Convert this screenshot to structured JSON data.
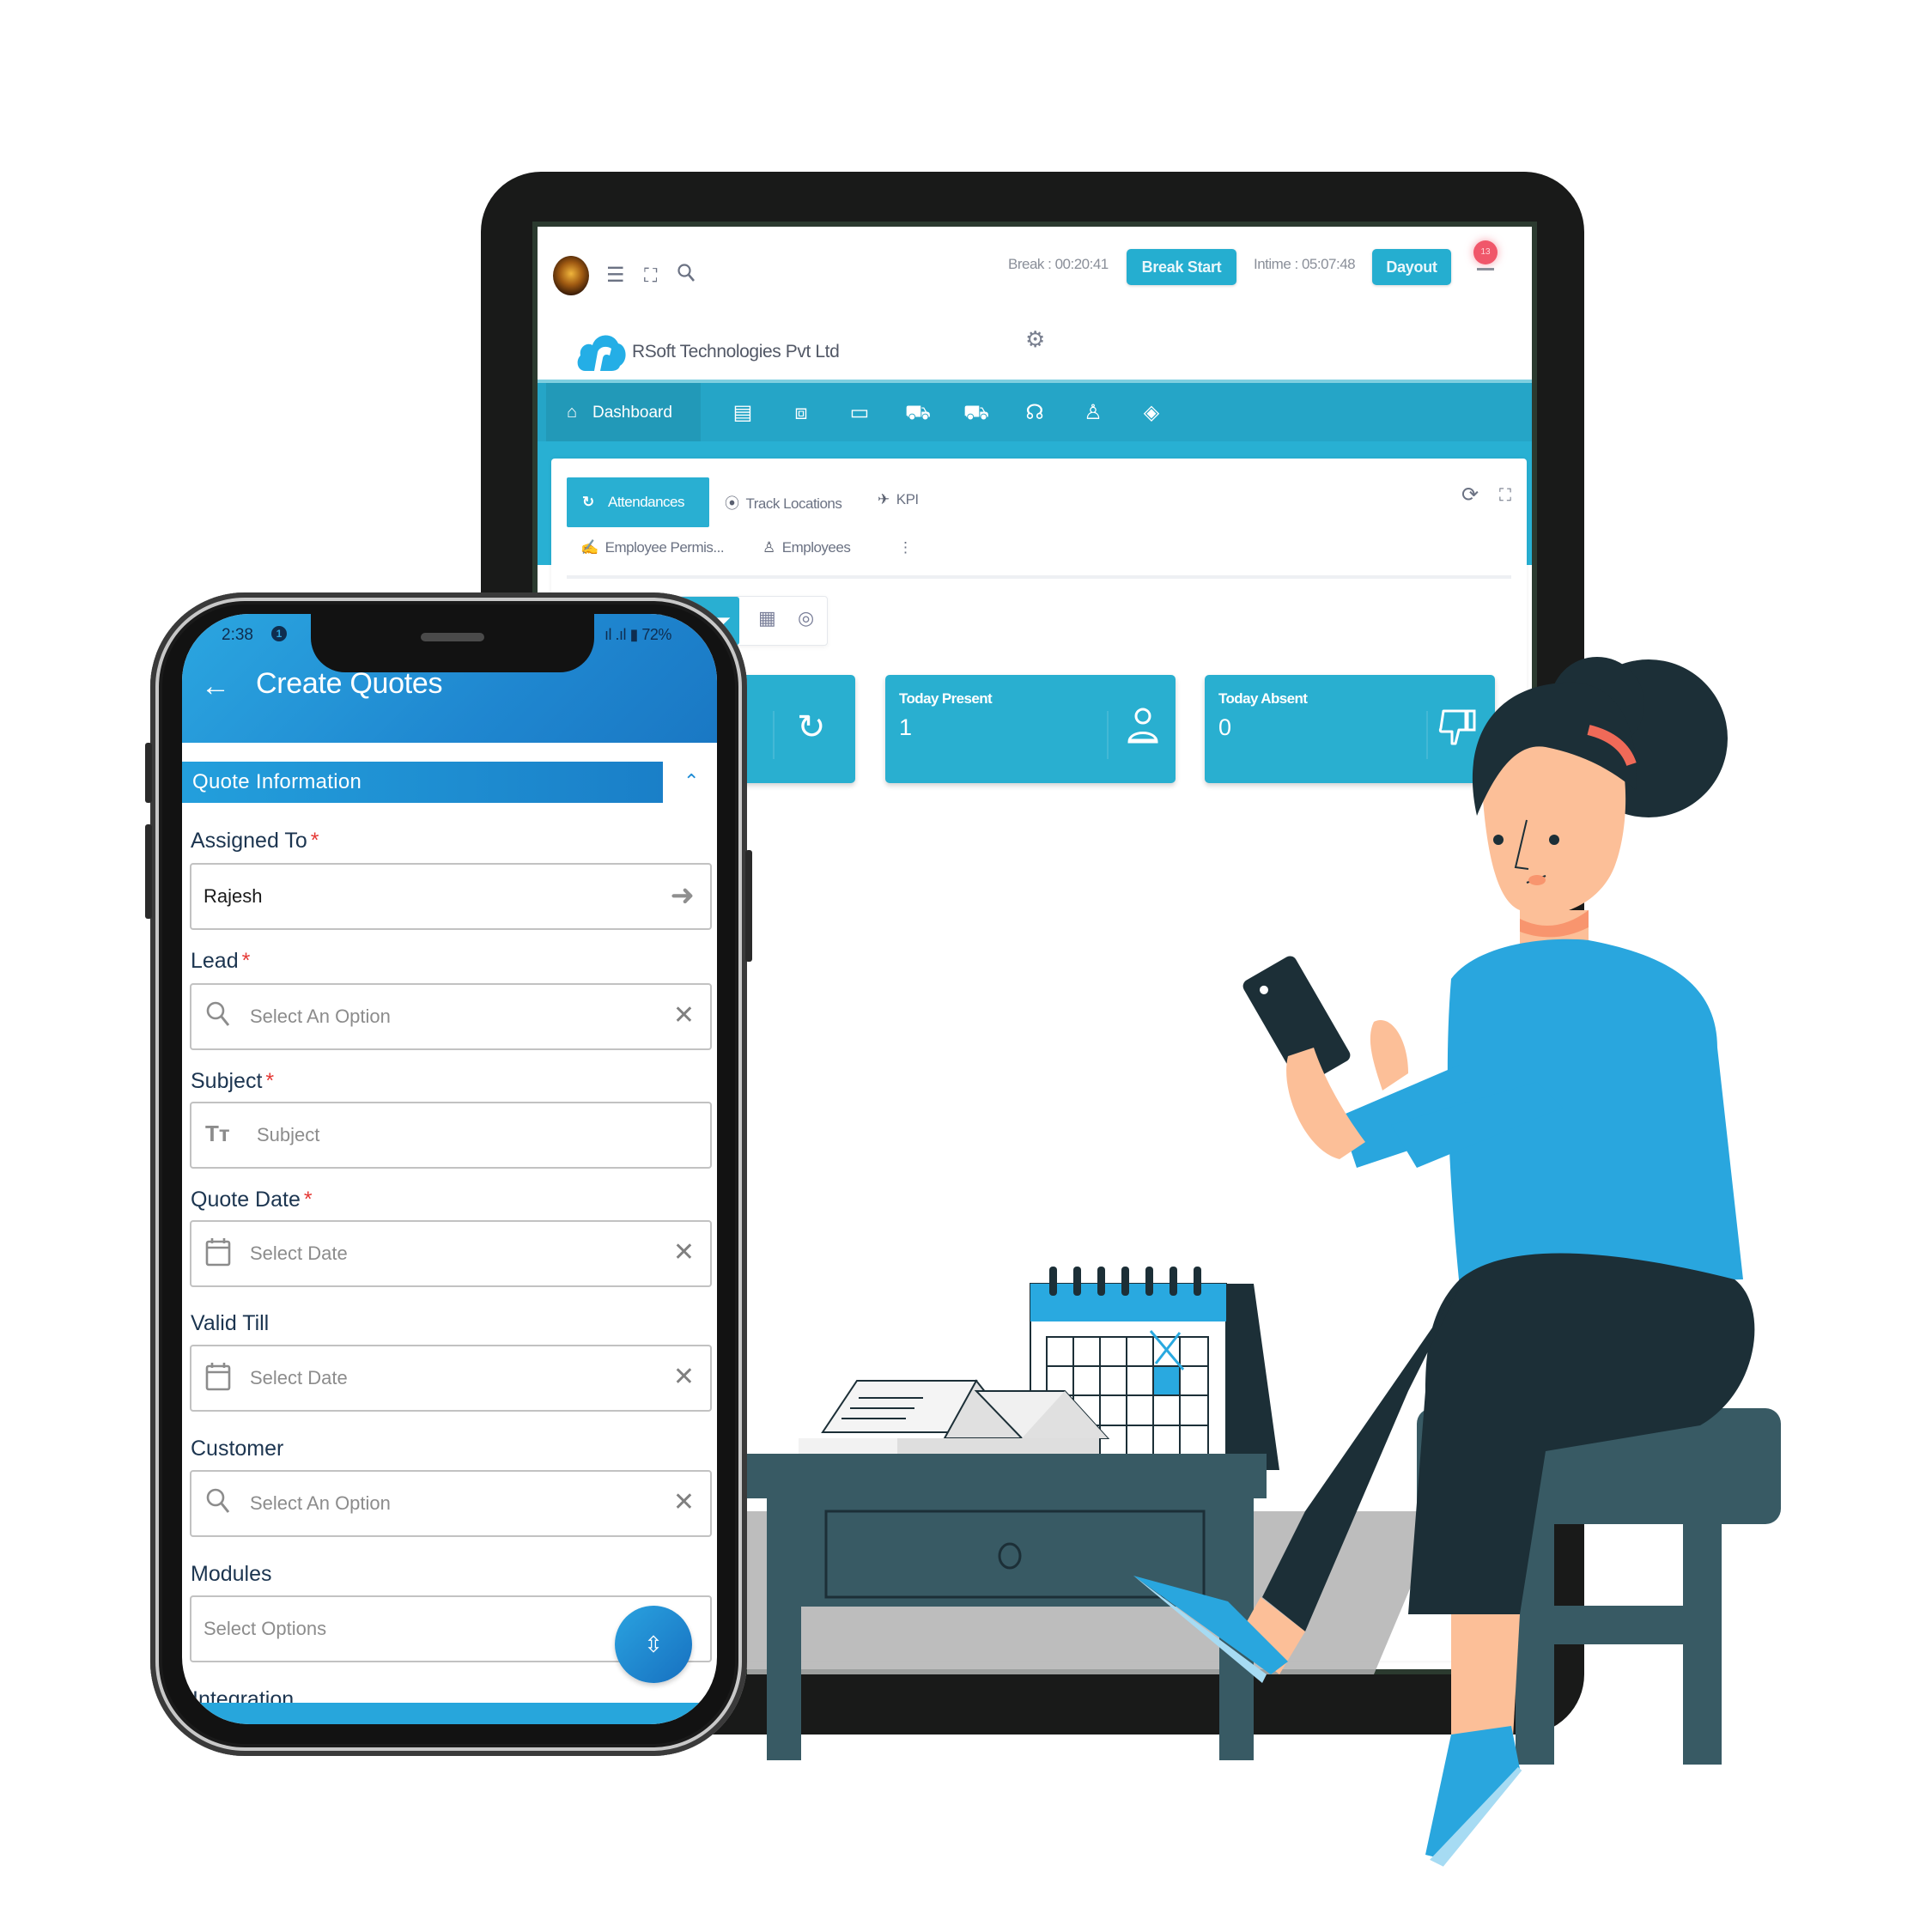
{
  "tablet": {
    "topbar": {
      "break_label": "Break : 00:20:41",
      "break_button": "Break Start",
      "intime_label": "Intime : 05:07:48",
      "dayout_button": "Dayout",
      "notification_count": "13",
      "icons": [
        "avatar",
        "menu-icon",
        "fullscreen-icon",
        "search-icon",
        "bell-icon"
      ]
    },
    "company_name": "RSoft Technologies Pvt Ltd",
    "nav": {
      "dashboard_label": "Dashboard",
      "icons": [
        "document-icon",
        "ticket-icon",
        "folder-icon",
        "cart-icon",
        "cart-add-icon",
        "headset-icon",
        "users-icon",
        "tag-icon"
      ]
    },
    "tabs": {
      "row1": [
        {
          "label": "Attendances",
          "icon": "clock-refresh-icon",
          "active": true
        },
        {
          "label": "Track Locations",
          "icon": "location-pin-icon",
          "active": false
        },
        {
          "label": "KPI",
          "icon": "rocket-icon",
          "active": false
        }
      ],
      "row2": [
        {
          "label": "Employee Permis...",
          "icon": "permission-icon"
        },
        {
          "label": "Employees",
          "icon": "user-icon"
        },
        {
          "label": "⋮",
          "icon": "more-icon"
        }
      ]
    },
    "stats": [
      {
        "title": "",
        "value": "",
        "icon": "clock-refresh-icon"
      },
      {
        "title": "Today Present",
        "value": "1",
        "icon": "user-icon"
      },
      {
        "title": "Today Absent",
        "value": "0",
        "icon": "thumbs-down-icon"
      }
    ]
  },
  "phone": {
    "status": {
      "time": "2:38",
      "notification": "1",
      "right": "ıl .ıl ▮ 72%"
    },
    "appbar_title": "Create Quotes",
    "section_title": "Quote Information",
    "fields": [
      {
        "label": "Assigned To",
        "required": true,
        "value": "Rajesh",
        "placeholder": ""
      },
      {
        "label": "Lead",
        "required": true,
        "value": "",
        "placeholder": "Select An Option"
      },
      {
        "label": "Subject",
        "required": true,
        "value": "",
        "placeholder": "Subject"
      },
      {
        "label": "Quote Date",
        "required": true,
        "value": "",
        "placeholder": "Select Date"
      },
      {
        "label": "Valid Till",
        "required": false,
        "value": "",
        "placeholder": "Select Date"
      },
      {
        "label": "Customer",
        "required": false,
        "value": "",
        "placeholder": "Select An Option"
      },
      {
        "label": "Modules",
        "required": false,
        "value": "",
        "placeholder": "Select Options"
      }
    ],
    "required_mark": "*",
    "peek_label": "Integration"
  },
  "colors": {
    "tablet_accent": "#29afd2",
    "phone_accent": "#1f87d0",
    "required": "#e53935"
  }
}
